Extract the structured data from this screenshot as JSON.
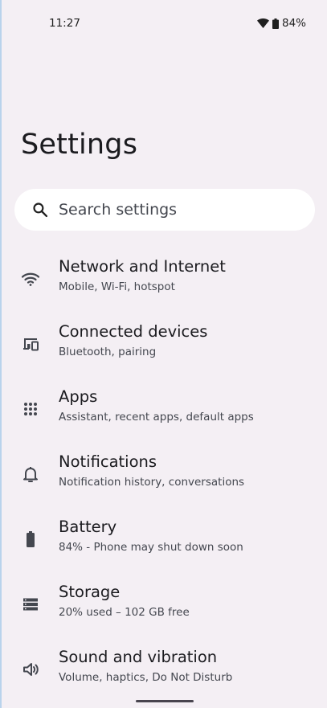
{
  "status_bar": {
    "time": "11:27",
    "battery_percent": "84%"
  },
  "page": {
    "title": "Settings"
  },
  "search": {
    "placeholder": "Search settings"
  },
  "settings_items": [
    {
      "icon": "wifi-icon",
      "title": "Network and Internet",
      "subtitle": "Mobile, Wi-Fi, hotspot"
    },
    {
      "icon": "connected-devices-icon",
      "title": "Connected devices",
      "subtitle": "Bluetooth, pairing"
    },
    {
      "icon": "apps-grid-icon",
      "title": "Apps",
      "subtitle": "Assistant, recent apps, default apps"
    },
    {
      "icon": "bell-icon",
      "title": "Notifications",
      "subtitle": "Notification history, conversations"
    },
    {
      "icon": "battery-icon",
      "title": "Battery",
      "subtitle": "84% - Phone may shut down soon"
    },
    {
      "icon": "storage-icon",
      "title": "Storage",
      "subtitle": "20% used – 102 GB free"
    },
    {
      "icon": "speaker-icon",
      "title": "Sound and vibration",
      "subtitle": "Volume, haptics, Do Not Disturb"
    }
  ],
  "colors": {
    "background": "#f4eff4",
    "search_background": "#ffffff",
    "text_primary": "#1b1b1f",
    "text_secondary": "#44474f"
  }
}
